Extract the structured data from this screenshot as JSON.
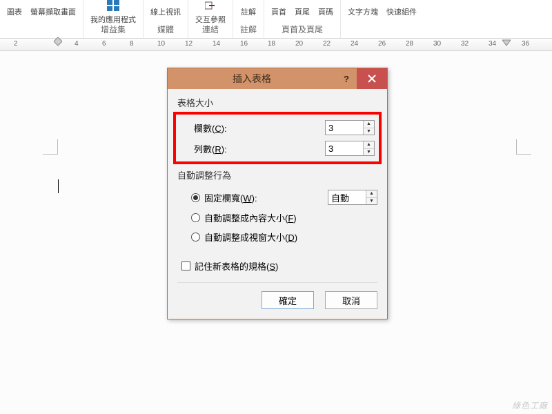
{
  "ribbon": {
    "groups": [
      {
        "items": [
          "圖表",
          "螢幕擷取畫面"
        ],
        "label": ""
      },
      {
        "appsLabel": "我的應用程式",
        "label": "增益集"
      },
      {
        "items": [
          "線上視訊"
        ],
        "label": "媒體"
      },
      {
        "crossRef": "交互參照",
        "label": "連結"
      },
      {
        "items": [
          "註解"
        ],
        "label": "註解"
      },
      {
        "items": [
          "頁首",
          "頁尾",
          "頁碼"
        ],
        "label": "頁首及頁尾"
      },
      {
        "items": [
          "文字方塊",
          "快速組件"
        ],
        "label": ""
      }
    ]
  },
  "ruler": {
    "ticks": [
      "2",
      "4",
      "6",
      "8",
      "10",
      "12",
      "14",
      "16",
      "18",
      "20",
      "22",
      "24",
      "26",
      "28",
      "30",
      "32",
      "34",
      "36"
    ]
  },
  "dialog": {
    "title": "插入表格",
    "sectionSize": "表格大小",
    "colsLabelPrefix": "欄數(",
    "colsKey": "C",
    "colsLabelSuffix": "):",
    "rowsLabelPrefix": "列數(",
    "rowsKey": "R",
    "rowsLabelSuffix": "):",
    "cols": "3",
    "rows": "3",
    "sectionAuto": "自動調整行為",
    "fixedPrefix": "固定欄寬(",
    "fixedKey": "W",
    "fixedSuffix": "):",
    "fixedValue": "自動",
    "fitContentPrefix": "自動調整成內容大小(",
    "fitContentKey": "F",
    "fitContentSuffix": ")",
    "fitWindowPrefix": "自動調整成視窗大小(",
    "fitWindowKey": "D",
    "fitWindowSuffix": ")",
    "rememberPrefix": "記住新表格的規格(",
    "rememberKey": "S",
    "rememberSuffix": ")",
    "ok": "確定",
    "cancel": "取消"
  },
  "watermark": "綠色工廠"
}
